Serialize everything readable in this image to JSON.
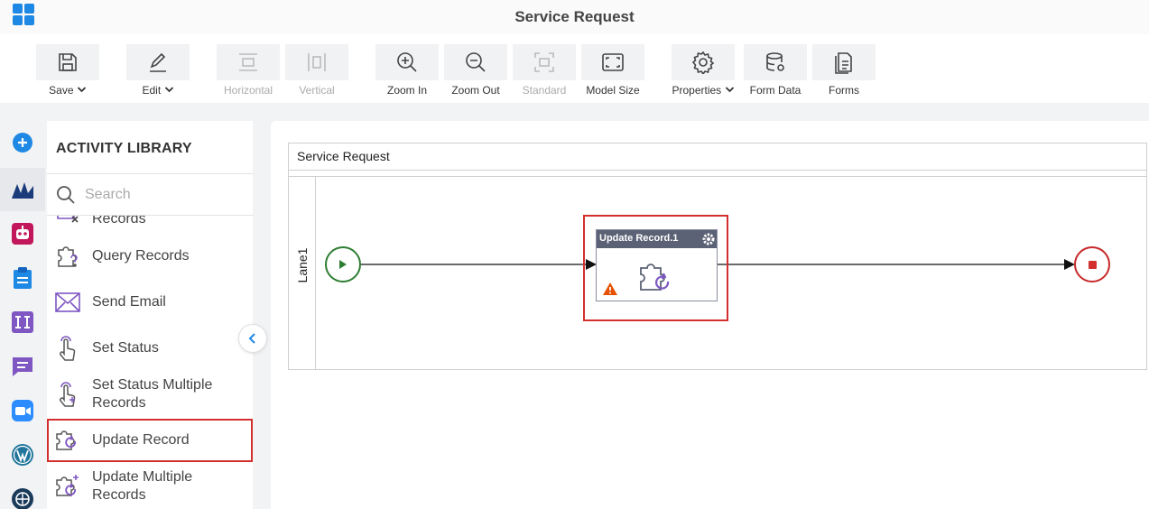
{
  "window": {
    "title": "Service Request"
  },
  "toolbar": {
    "save": "Save",
    "edit": "Edit",
    "horizontal": "Horizontal",
    "vertical": "Vertical",
    "zoom_in": "Zoom In",
    "zoom_out": "Zoom Out",
    "standard": "Standard",
    "model_size": "Model Size",
    "properties": "Properties",
    "form_data": "Form Data",
    "forms": "Forms"
  },
  "rail": {
    "icons": [
      "add-icon",
      "dynamics-icon",
      "bot-icon",
      "clipboard-icon",
      "text-box-icon",
      "chat-icon",
      "zoom-icon",
      "wordpress-icon",
      "globe-icon"
    ]
  },
  "library": {
    "title": "ACTIVITY LIBRARY",
    "search_placeholder": "Search",
    "items": [
      {
        "label": "Records",
        "icon": "delete-records-icon"
      },
      {
        "label": "Query Records",
        "icon": "query-records-icon"
      },
      {
        "label": "Send Email",
        "icon": "email-icon"
      },
      {
        "label": "Set Status",
        "icon": "set-status-icon"
      },
      {
        "label_line1": "Set Status Multiple",
        "label_line2": "Records",
        "icon": "set-status-multiple-icon"
      },
      {
        "label": "Update Record",
        "icon": "update-record-icon",
        "selected": true
      },
      {
        "label_line1": "Update Multiple",
        "label_line2": "Records",
        "icon": "update-multiple-icon"
      }
    ]
  },
  "canvas": {
    "pool_title": "Service Request",
    "lane_label": "Lane1",
    "task_title": "Update Record.1"
  },
  "colors": {
    "accent": "#1e88e5",
    "purple": "#7e57c2",
    "highlight": "#d32f2f",
    "start": "#2e7d32",
    "end": "#c62828",
    "warning": "#e65100"
  }
}
